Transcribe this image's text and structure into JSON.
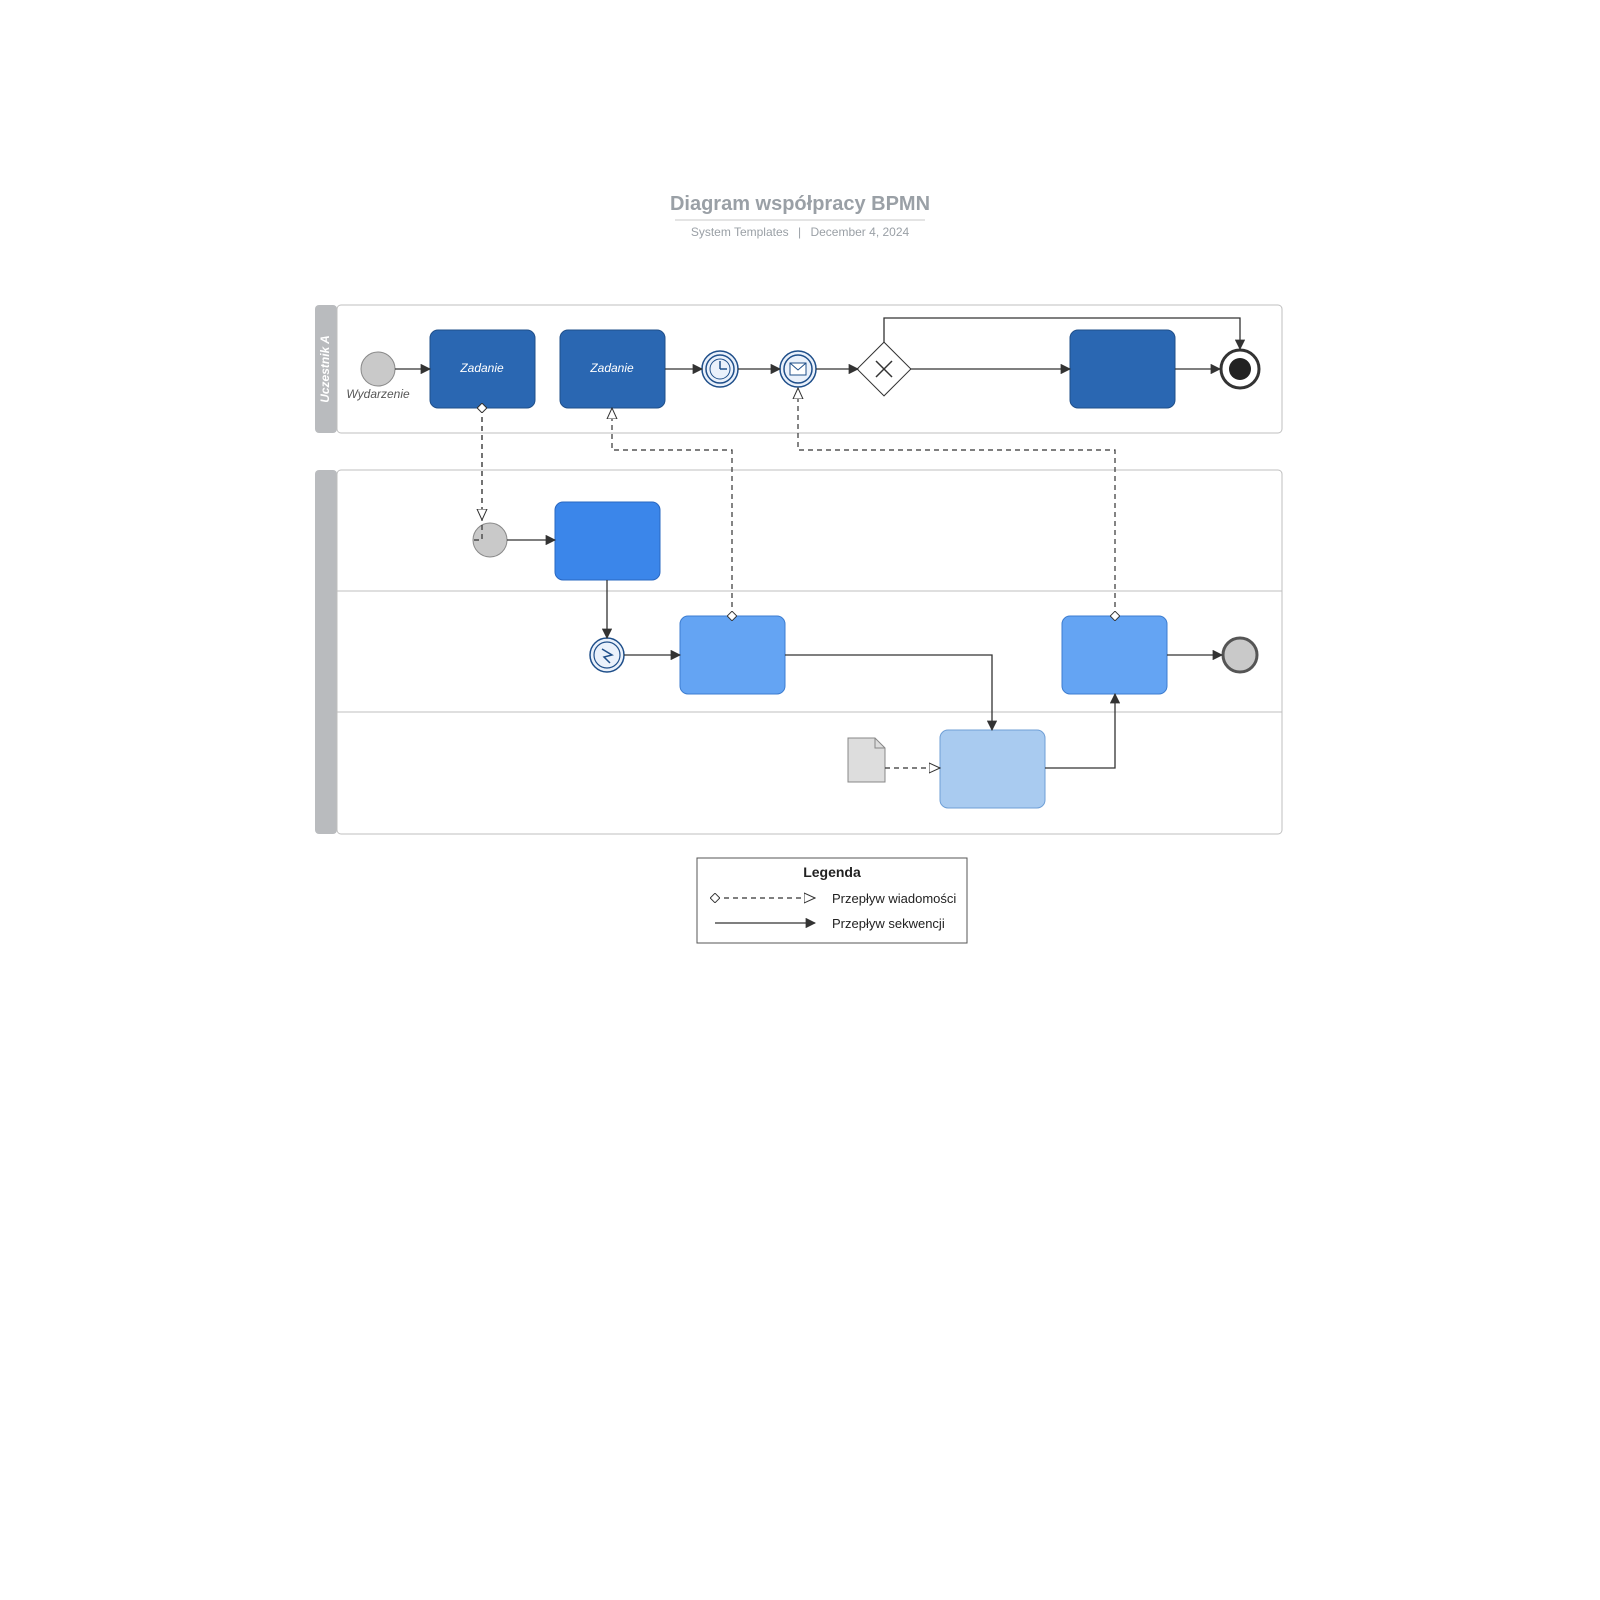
{
  "header": {
    "title": "Diagram współpracy BPMN",
    "subtitle_left": "System Templates",
    "subtitle_sep": "|",
    "subtitle_right": "December 4, 2024"
  },
  "poolA": {
    "title": "Uczestnik A"
  },
  "labels": {
    "event": "Wydarzenie",
    "task1": "Zadanie",
    "task2": "Zadanie"
  },
  "legend": {
    "title": "Legenda",
    "message_flow": "Przepływ wiadomości",
    "sequence_flow": "Przepływ sekwencji"
  },
  "colors": {
    "dark": "#2a67b2",
    "mid": "#3b86ea",
    "light": "#64a4f3",
    "pale": "#a9cbf0",
    "grey": "#c9c9c9",
    "stroke": "#333"
  }
}
